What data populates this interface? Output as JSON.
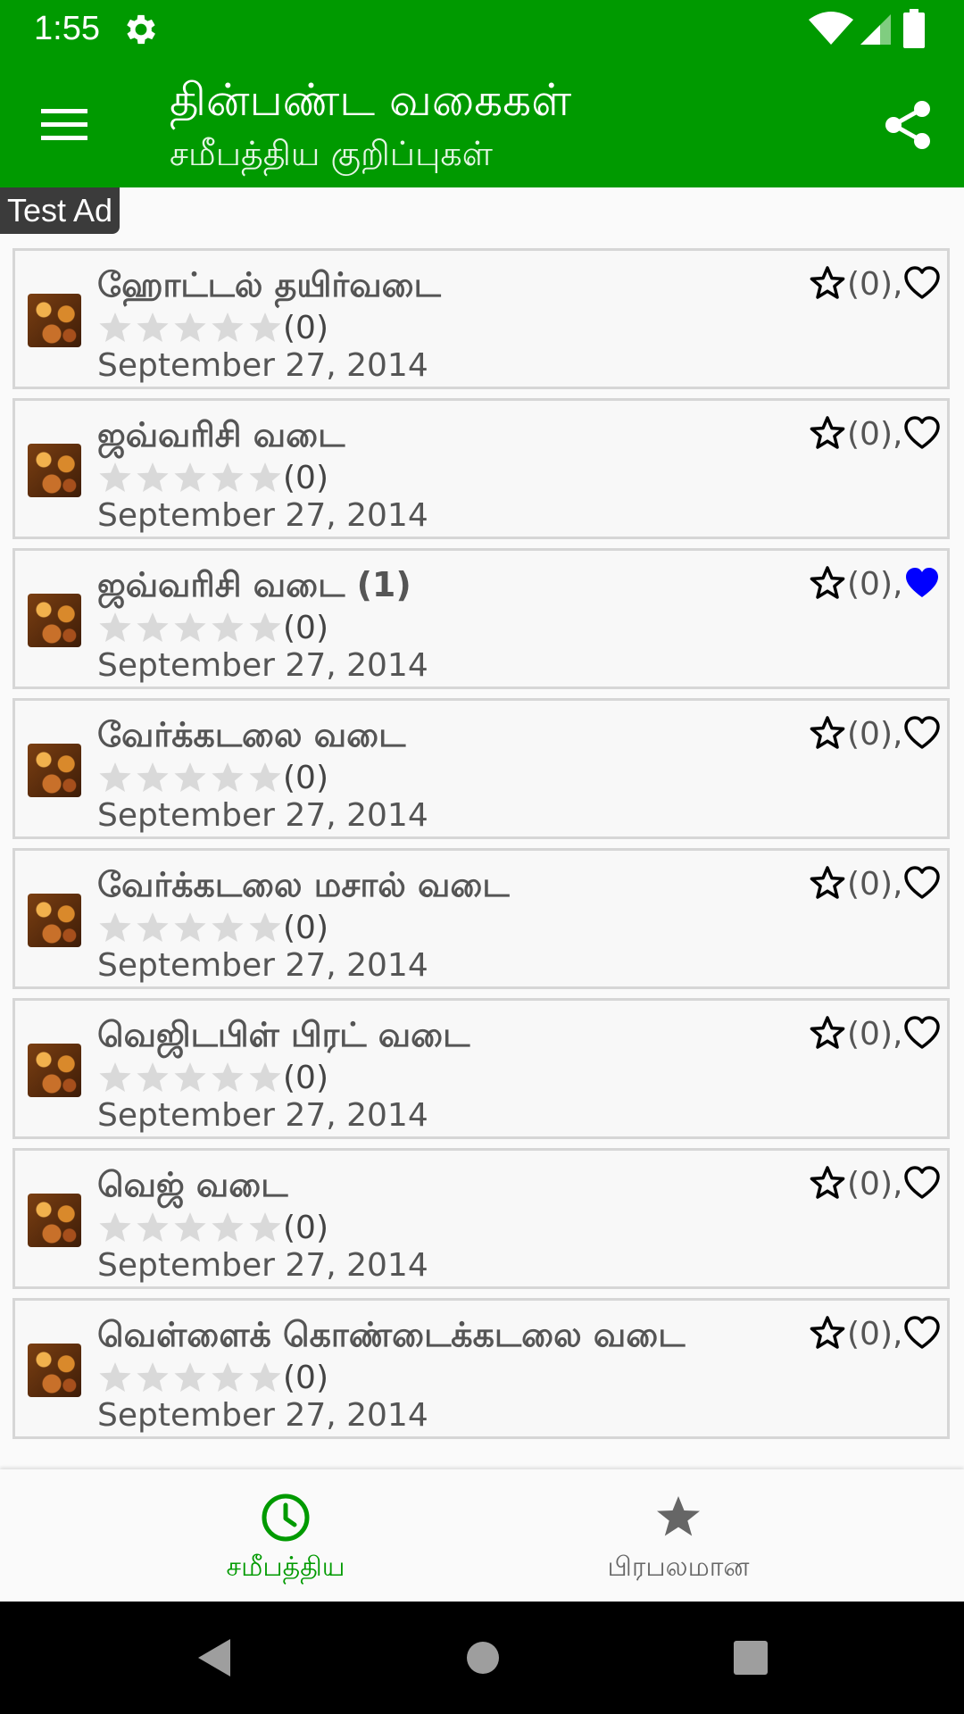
{
  "status_bar": {
    "time": "1:55"
  },
  "app_bar": {
    "title": "தின்பண்ட வகைகள்",
    "subtitle": "சமீபத்திய குறிப்புகள்",
    "accent_color": "#009a00"
  },
  "ad": {
    "label": "Test Ad"
  },
  "list": {
    "items": [
      {
        "title": "ஹோட்டல் தயிர்வடை",
        "rating_count": "(0)",
        "date": "September 27, 2014",
        "fav_count": "(0),",
        "favorited": false,
        "rating": 0
      },
      {
        "title": "ஜவ்வரிசி வடை",
        "rating_count": "(0)",
        "date": "September 27, 2014",
        "fav_count": "(0),",
        "favorited": false,
        "rating": 0
      },
      {
        "title": "ஜவ்வரிசி வடை (1)",
        "rating_count": "(0)",
        "date": "September 27, 2014",
        "fav_count": "(0),",
        "favorited": true,
        "rating": 0
      },
      {
        "title": "வேர்க்கடலை வடை",
        "rating_count": "(0)",
        "date": "September 27, 2014",
        "fav_count": "(0),",
        "favorited": false,
        "rating": 0
      },
      {
        "title": "வேர்க்கடலை மசால் வடை",
        "rating_count": "(0)",
        "date": "September 27, 2014",
        "fav_count": "(0),",
        "favorited": false,
        "rating": 0
      },
      {
        "title": "வெஜிடபிள் பிரட் வடை",
        "rating_count": "(0)",
        "date": "September 27, 2014",
        "fav_count": "(0),",
        "favorited": false,
        "rating": 0
      },
      {
        "title": "வெஜ் வடை",
        "rating_count": "(0)",
        "date": "September 27, 2014",
        "fav_count": "(0),",
        "favorited": false,
        "rating": 0
      },
      {
        "title": "வெள்ளைக் கொண்டைக்கடலை வடை",
        "rating_count": "(0)",
        "date": "September 27, 2014",
        "fav_count": "(0),",
        "favorited": false,
        "rating": 0
      }
    ]
  },
  "bottom_nav": {
    "tabs": [
      {
        "label": "சமீபத்திய",
        "icon": "clock-icon",
        "active": true
      },
      {
        "label": "பிரபலமான",
        "icon": "star-icon",
        "active": false
      }
    ],
    "active_color": "#009a00",
    "inactive_color": "#666666"
  },
  "colors": {
    "favorite_active": "#0000ff"
  }
}
